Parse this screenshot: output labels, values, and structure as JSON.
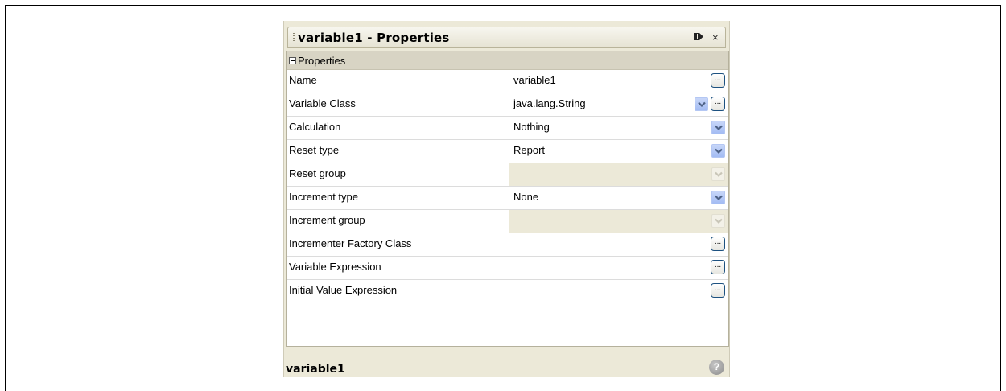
{
  "panel": {
    "title": "variable1 - Properties",
    "dock_icon": "dock-icon",
    "close_label": "×"
  },
  "category": {
    "label": "Properties"
  },
  "properties": [
    {
      "name": "Name",
      "value": "variable1",
      "editor": "ellipsis"
    },
    {
      "name": "Variable Class",
      "value": "java.lang.String",
      "editor": "combo-ellipsis"
    },
    {
      "name": "Calculation",
      "value": "Nothing",
      "editor": "combo"
    },
    {
      "name": "Reset type",
      "value": "Report",
      "editor": "combo"
    },
    {
      "name": "Reset group",
      "value": "",
      "editor": "combo-disabled"
    },
    {
      "name": "Increment type",
      "value": "None",
      "editor": "combo"
    },
    {
      "name": "Increment group",
      "value": "",
      "editor": "combo-disabled"
    },
    {
      "name": "Incrementer Factory Class",
      "value": "",
      "editor": "ellipsis"
    },
    {
      "name": "Variable Expression",
      "value": "",
      "editor": "ellipsis"
    },
    {
      "name": "Initial Value Expression",
      "value": "",
      "editor": "ellipsis"
    }
  ],
  "ellipsis_label": "...",
  "description": {
    "title": "variable1",
    "help_icon": "help-icon"
  }
}
